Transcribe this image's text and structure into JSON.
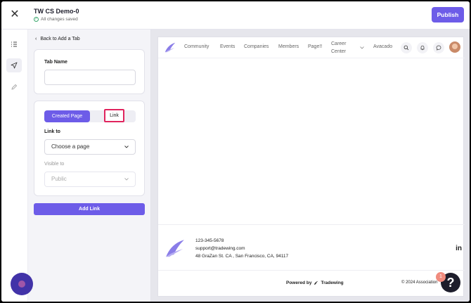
{
  "header": {
    "title": "TW CS Demo-0",
    "save_status": "All changes saved",
    "publish_label": "Publish"
  },
  "rail": {
    "items": [
      {
        "icon": "list-icon",
        "active": false
      },
      {
        "icon": "navigation-arrow-icon",
        "active": true
      },
      {
        "icon": "pencil-icon",
        "active": false
      }
    ]
  },
  "panel": {
    "back_label": "Back to Add a Tab",
    "tab_name_label": "Tab Name",
    "tab_name_value": "",
    "toggle": {
      "created_page_label": "Created Page",
      "link_label": "Link",
      "selected": "Created Page"
    },
    "link_to_label": "Link to",
    "link_to_value": "Choose a page",
    "visible_to_label": "Visible to",
    "visible_to_value": "Public",
    "add_link_label": "Add Link"
  },
  "preview": {
    "nav_items": [
      "Community",
      "Events",
      "Companies",
      "Members",
      "Page!!"
    ],
    "career_center_line1": "Career",
    "career_center_line2": "Center",
    "avacado_label": "Avacado",
    "footer": {
      "phone": "123-345-5678",
      "email": "support@tradewing.com",
      "address": "48 GraZan St. CA , San Francisco, CA, 94117",
      "linkedin_label": "in",
      "powered_by": "Powered by",
      "brand": "Tradewing",
      "copyright": "© 2024 Association"
    }
  },
  "widgets": {
    "help_label": "?",
    "help_badge_count": "1"
  },
  "colors": {
    "accent": "#6d5ce8",
    "highlight_border": "#e0245e"
  }
}
